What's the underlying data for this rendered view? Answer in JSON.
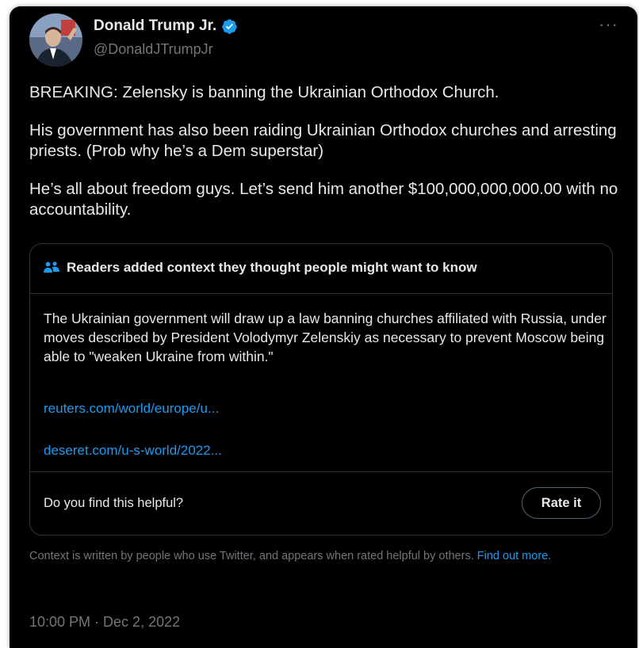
{
  "author": {
    "name": "Donald Trump Jr.",
    "handle": "@DonaldJTrumpJr",
    "verified_color": "#1d9bf0"
  },
  "menu": {
    "more_label": "···"
  },
  "tweet": {
    "paragraphs": [
      "BREAKING: Zelensky is banning the Ukrainian Orthodox Church.",
      "His government has also been raiding Ukrainian Orthodox churches and arresting priests. (Prob why he’s a Dem superstar)",
      "He’s all about freedom guys. Let’s send him another $100,000,000,000.00 with no accountability."
    ]
  },
  "community_note": {
    "title": "Readers added context they thought people might want to know",
    "body": "The Ukrainian government will draw up a law banning churches affiliated with Russia, under moves described by President Volodymyr Zelenskiy as necessary to prevent Moscow being able to \"weaken Ukraine from within.\"",
    "links": [
      "reuters.com/world/europe/u...",
      "deseret.com/u-s-world/2022..."
    ],
    "helpful_question": "Do you find this helpful?",
    "rate_button": "Rate it"
  },
  "context_footer": {
    "text": "Context is written by people who use Twitter, and appears when rated helpful by others. ",
    "link": "Find out more."
  },
  "timestamp": "10:00 PM · Dec 2, 2022",
  "colors": {
    "background": "#000000",
    "text": "#e7e9ea",
    "secondary": "#71767b",
    "accent": "#1d9bf0",
    "border": "#2f3336"
  }
}
